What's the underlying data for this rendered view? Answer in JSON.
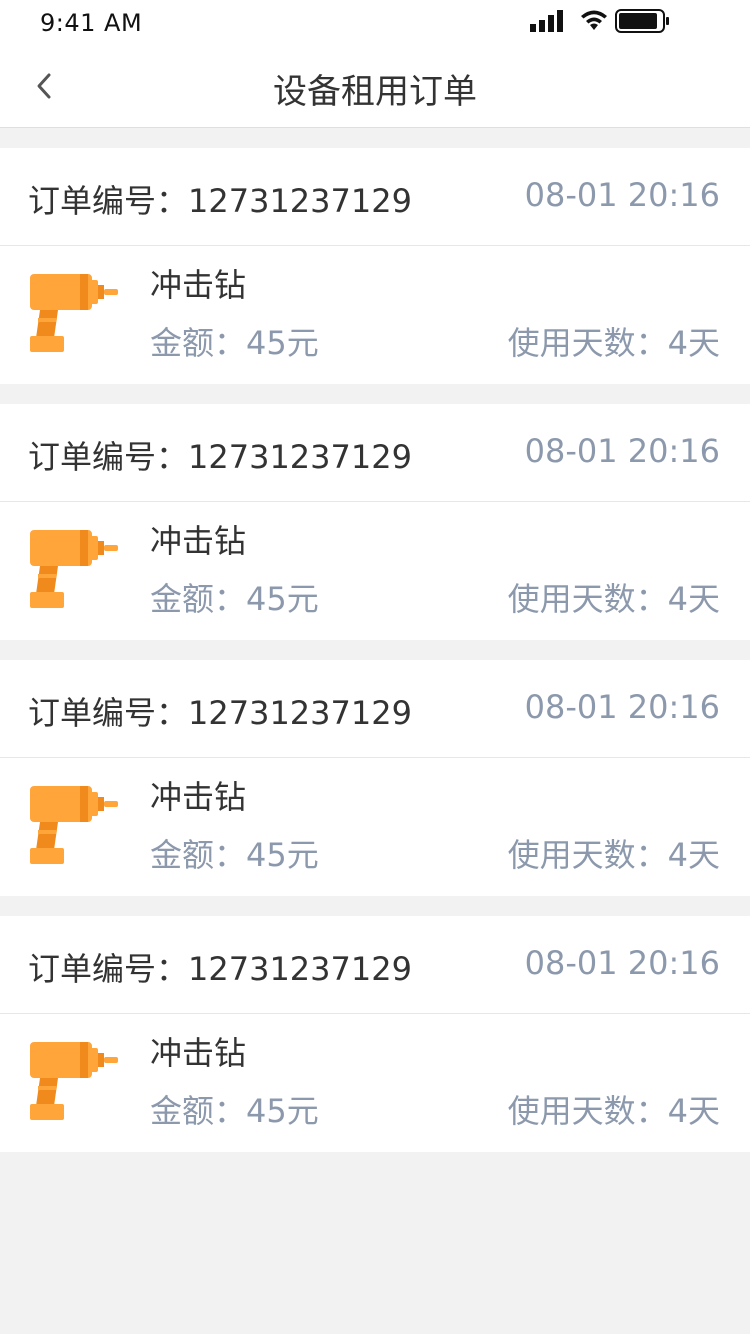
{
  "status_bar": {
    "time": "9:41 AM"
  },
  "nav": {
    "title": "设备租用订单"
  },
  "colors": {
    "accent": "#FFA53A",
    "secondary_text": "#8c99ac",
    "primary_text": "#333333",
    "background": "#f2f2f2"
  },
  "orders": [
    {
      "order_no": "订单编号：12731237129",
      "time": "08-01 20:16",
      "item_name": "冲击钻",
      "amount": "金额：45元",
      "days": "使用天数：4天",
      "icon": "drill-icon"
    },
    {
      "order_no": "订单编号：12731237129",
      "time": "08-01 20:16",
      "item_name": "冲击钻",
      "amount": "金额：45元",
      "days": "使用天数：4天",
      "icon": "drill-icon"
    },
    {
      "order_no": "订单编号：12731237129",
      "time": "08-01 20:16",
      "item_name": "冲击钻",
      "amount": "金额：45元",
      "days": "使用天数：4天",
      "icon": "drill-icon"
    },
    {
      "order_no": "订单编号：12731237129",
      "time": "08-01 20:16",
      "item_name": "冲击钻",
      "amount": "金额：45元",
      "days": "使用天数：4天",
      "icon": "drill-icon"
    }
  ]
}
